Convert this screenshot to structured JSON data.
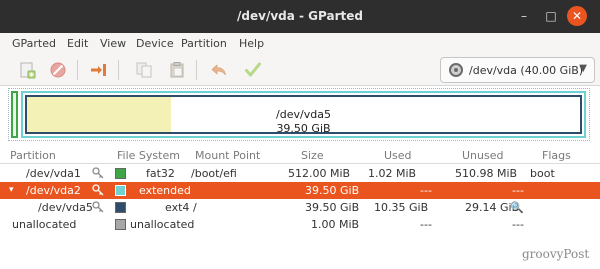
{
  "window": {
    "title": "/dev/vda - GParted"
  },
  "window_controls": {
    "minimize": "–",
    "maximize": "□",
    "close": "✕"
  },
  "menu": [
    "GParted",
    "Edit",
    "View",
    "Device",
    "Partition",
    "Help"
  ],
  "toolbar": {
    "icons": [
      "new-partition-icon",
      "delete-icon",
      "resize-move-icon",
      "copy-icon",
      "paste-icon",
      "undo-icon",
      "apply-icon"
    ],
    "device_selector": {
      "label": "/dev/vda (40.00 GiB)",
      "icon": "disk-icon"
    }
  },
  "graphic": {
    "label_name": "/dev/vda5",
    "label_size": "39.50 GiB",
    "used_fraction": 0.26,
    "colors": {
      "fat32": "#3fa547",
      "extended": "#6fd1d1",
      "ext4": "#2f4d6b",
      "used": "#f4f1b6"
    }
  },
  "table": {
    "headers": [
      "Partition",
      "File System",
      "Mount Point",
      "Size",
      "Used",
      "Unused",
      "Flags"
    ],
    "rows": [
      {
        "partition": "/dev/vda1",
        "fs": "fat32",
        "fs_color": "#3fa547",
        "mount": "/boot/efi",
        "size": "512.00 MiB",
        "used": "1.02 MiB",
        "unused": "510.98 MiB",
        "flags": "boot",
        "key": true
      },
      {
        "partition": "/dev/vda2",
        "fs": "extended",
        "fs_color": "#6fd1d1",
        "mount": "",
        "size": "39.50 GiB",
        "used": "---",
        "unused": "---",
        "flags": "",
        "key": true,
        "expander": "▾"
      },
      {
        "partition": "/dev/vda5",
        "fs": "ext4",
        "fs_color": "#2f4d6b",
        "mount": "/",
        "size": "39.50 GiB",
        "used": "10.35 GiB",
        "unused": "29.14 GiB",
        "flags": "",
        "key": true
      },
      {
        "partition": "unallocated",
        "fs": "unallocated",
        "fs_color": "#a8a8a8",
        "mount": "",
        "size": "1.00 MiB",
        "used": "---",
        "unused": "---",
        "flags": "",
        "key": false
      }
    ]
  },
  "watermark": "groovyPost",
  "accent": "#e9541f"
}
